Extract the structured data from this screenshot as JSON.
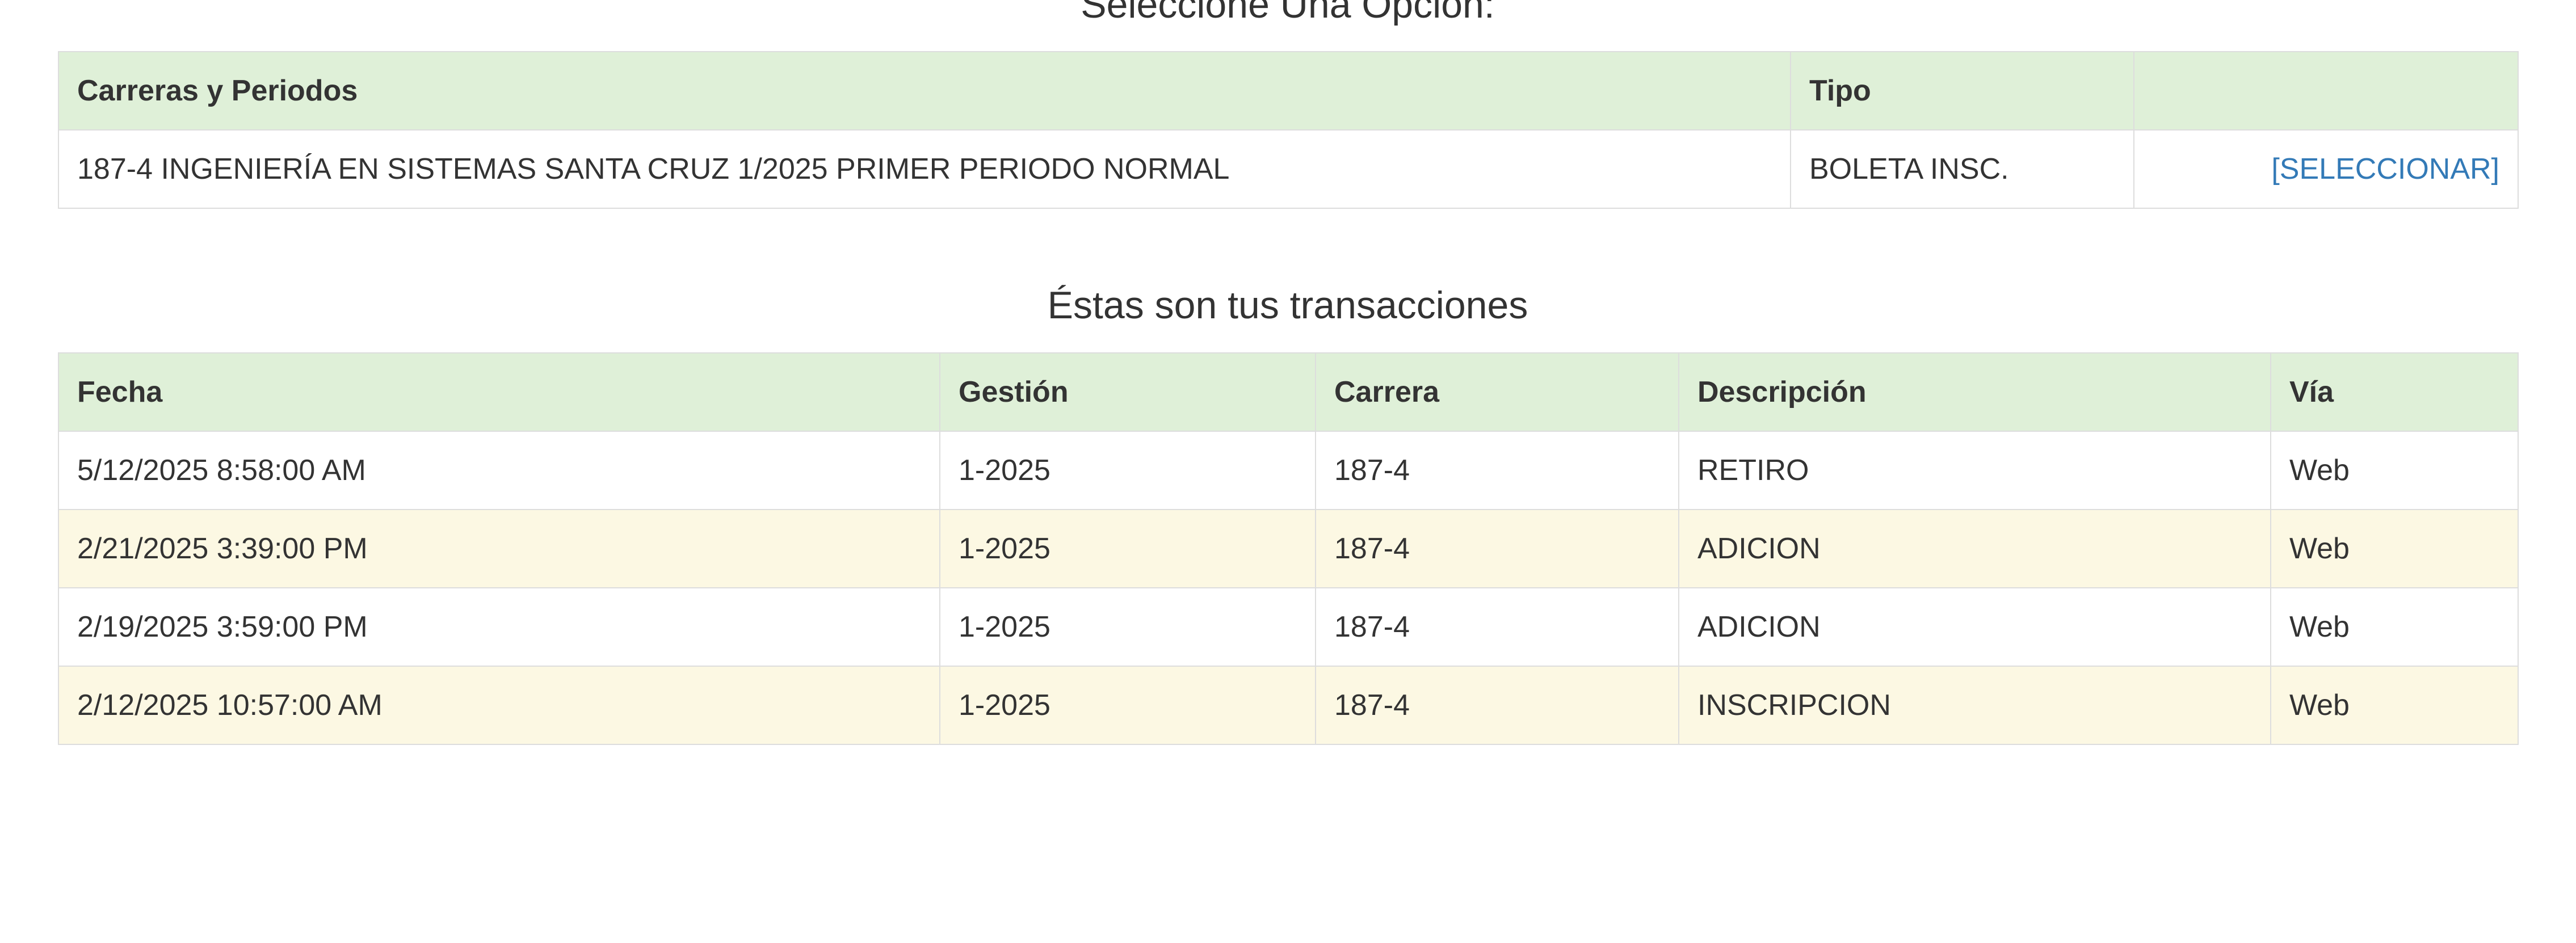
{
  "options_section": {
    "title": "Seleccione Una Opción:",
    "headers": [
      "Carreras y Periodos",
      "Tipo",
      ""
    ],
    "rows": [
      {
        "career_period": "187-4 INGENIERÍA EN SISTEMAS SANTA CRUZ 1/2025 PRIMER PERIODO NORMAL",
        "type": "BOLETA INSC.",
        "action": "[SELECCIONAR]"
      }
    ]
  },
  "transactions_section": {
    "title": "Éstas son tus transacciones",
    "headers": [
      "Fecha",
      "Gestión",
      "Carrera",
      "Descripción",
      "Vía"
    ],
    "rows": [
      [
        "5/12/2025 8:58:00 AM",
        "1-2025",
        "187-4",
        "RETIRO",
        "Web"
      ],
      [
        "2/21/2025 3:39:00 PM",
        "1-2025",
        "187-4",
        "ADICION",
        "Web"
      ],
      [
        "2/19/2025 3:59:00 PM",
        "1-2025",
        "187-4",
        "ADICION",
        "Web"
      ],
      [
        "2/12/2025 10:57:00 AM",
        "1-2025",
        "187-4",
        "INSCRIPCION",
        "Web"
      ]
    ]
  },
  "colors": {
    "header_bg": "#dff0d8",
    "striped_row_bg": "#fcf8e3",
    "link": "#337ab7",
    "border": "#dddddd"
  }
}
